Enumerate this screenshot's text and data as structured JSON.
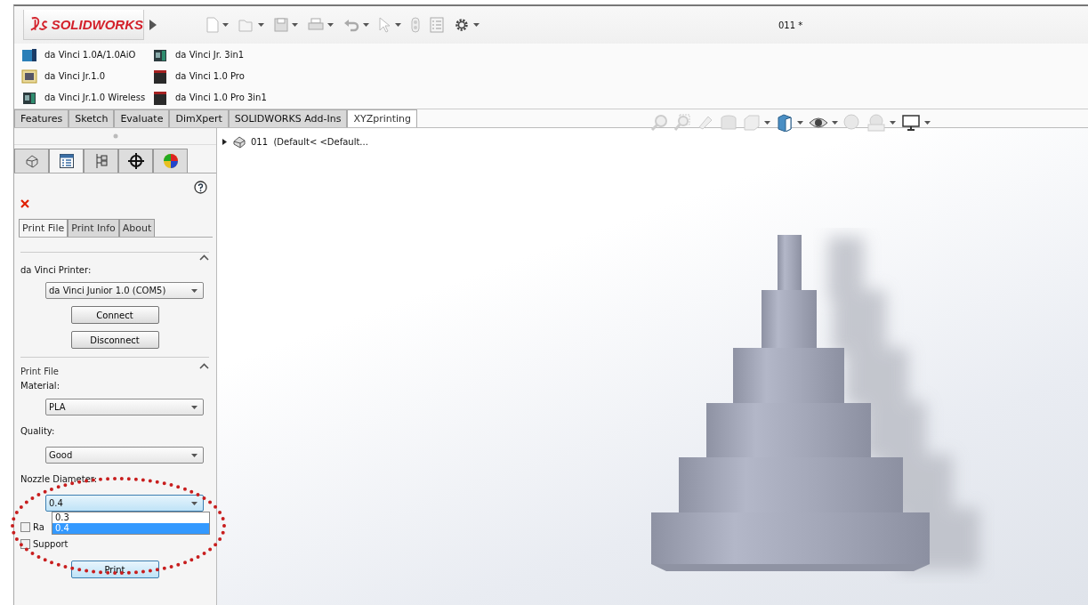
{
  "window": {
    "title": "011 *"
  },
  "logo": {
    "text": "SOLIDWORKS"
  },
  "printers": [
    {
      "label": "da Vinci 1.0A/1.0AiO",
      "kind": "aio"
    },
    {
      "label": "da Vinci Jr. 3in1",
      "kind": "junior"
    },
    {
      "label": "da Vinci Jr.1.0",
      "kind": "classic"
    },
    {
      "label": "da Vinci 1.0 Pro",
      "kind": "pro"
    },
    {
      "label": "da Vinci Jr.1.0 Wireless",
      "kind": "junior"
    },
    {
      "label": "da Vinci 1.0 Pro 3in1",
      "kind": "pro"
    }
  ],
  "command_tabs": [
    {
      "label": "Features",
      "selected": false
    },
    {
      "label": "Sketch",
      "selected": false
    },
    {
      "label": "Evaluate",
      "selected": false
    },
    {
      "label": "DimXpert",
      "selected": false
    },
    {
      "label": "SOLIDWORKS Add-Ins",
      "selected": false
    },
    {
      "label": "XYZprinting",
      "selected": true
    }
  ],
  "panel_tabs": [
    {
      "kind": "part",
      "selected": false
    },
    {
      "kind": "property",
      "selected": true
    },
    {
      "kind": "config",
      "selected": false
    },
    {
      "kind": "crosshair",
      "selected": false
    },
    {
      "kind": "appearance",
      "selected": false
    }
  ],
  "property_tabs": [
    {
      "label": "Print File",
      "selected": true
    },
    {
      "label": "Print Info",
      "selected": false
    },
    {
      "label": "About",
      "selected": false
    }
  ],
  "printer_section": {
    "label": "da Vinci Printer:",
    "value": "da Vinci Junior 1.0 (COM5)",
    "buttons": [
      "Connect",
      "Disconnect"
    ]
  },
  "print_file_section": {
    "title": "Print File",
    "fields": [
      {
        "label": "Material:",
        "value": "PLA",
        "expanded": false
      },
      {
        "label": "Quality:",
        "value": "Good",
        "expanded": false
      },
      {
        "label": "Nozzle Diameter:",
        "value": "0.4",
        "expanded": true,
        "options": [
          {
            "label": "0.3",
            "selected": false
          },
          {
            "label": "0.4",
            "selected": true
          }
        ]
      }
    ],
    "checkboxes": [
      {
        "label": "Ra",
        "checked": false
      },
      {
        "label": "Support",
        "checked": false
      }
    ],
    "button": "Print"
  },
  "tree": {
    "label": "011  (Default< <Default...",
    "expanded": false
  }
}
